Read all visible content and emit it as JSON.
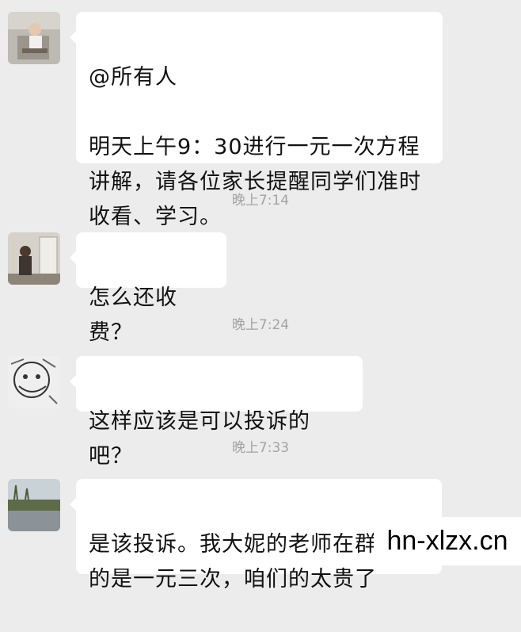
{
  "messages": [
    {
      "avatar": "child-on-chair-photo",
      "mention": "@所有人",
      "text": "明天上午9：30进行一元一次方程\n讲解，请各位家长提醒同学们准时\n收看、学习。"
    },
    {
      "avatar": "woman-in-room-photo",
      "text": "怎么还收费？"
    },
    {
      "avatar": "sketch-face-photo",
      "text": "这样应该是可以投诉的吧？"
    },
    {
      "avatar": "lake-landscape-photo",
      "text": "是该投诉。我大妮的老师在群里发\n的是一元三次，咱们的太贵了"
    }
  ],
  "timestamps": [
    "晚上7:14",
    "晚上7:24",
    "晚上7:33"
  ],
  "watermark": {
    "text": "hn-xlzx.cn"
  }
}
